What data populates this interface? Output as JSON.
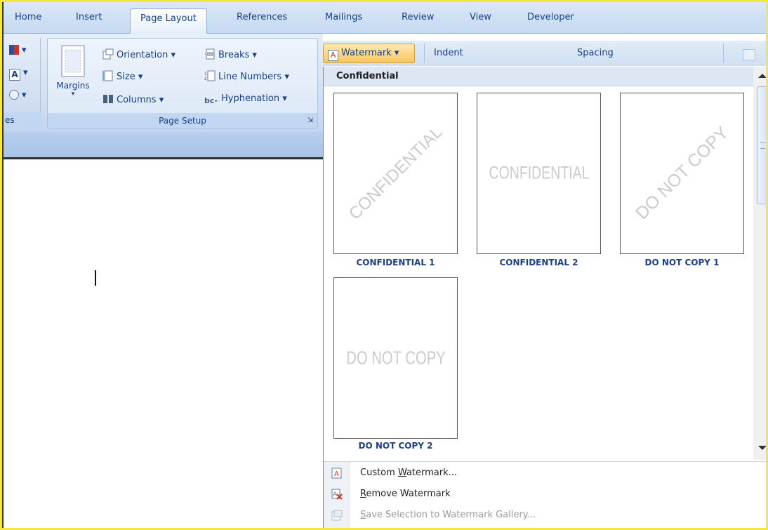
{
  "tabs": [
    "Home",
    "Insert",
    "Page Layout",
    "References",
    "Mailings",
    "Review",
    "View",
    "Developer"
  ],
  "ribbon": {
    "left_group_label": "es",
    "page_setup": {
      "margins": "Margins",
      "orientation": "Orientation",
      "size": "Size",
      "columns": "Columns",
      "breaks": "Breaks",
      "line_numbers": "Line Numbers",
      "hyphenation": "Hyphenation",
      "group_label": "Page Setup"
    },
    "watermark": "Watermark",
    "indent": "Indent",
    "spacing": "Spacing"
  },
  "gallery": {
    "section": "Confidential",
    "items": [
      {
        "preview": "CONFIDENTIAL",
        "caption": "CONFIDENTIAL 1",
        "style": "diagonal"
      },
      {
        "preview": "CONFIDENTIAL",
        "caption": "CONFIDENTIAL 2",
        "style": "horizontal"
      },
      {
        "preview": "DO NOT COPY",
        "caption": "DO NOT COPY 1",
        "style": "diagonal"
      },
      {
        "preview": "DO NOT COPY",
        "caption": "DO NOT COPY 2",
        "style": "horizontal"
      }
    ]
  },
  "menu": {
    "custom": {
      "pre": "Custom ",
      "key": "W",
      "post": "atermark..."
    },
    "remove": {
      "pre": "",
      "key": "R",
      "post": "emove Watermark"
    },
    "save": {
      "pre": "",
      "key": "S",
      "post": "ave Selection to Watermark Gallery..."
    }
  },
  "colors": {
    "accent": "#15428b",
    "active_button": "#f7c75f",
    "frame_border": "#f5e83a"
  }
}
